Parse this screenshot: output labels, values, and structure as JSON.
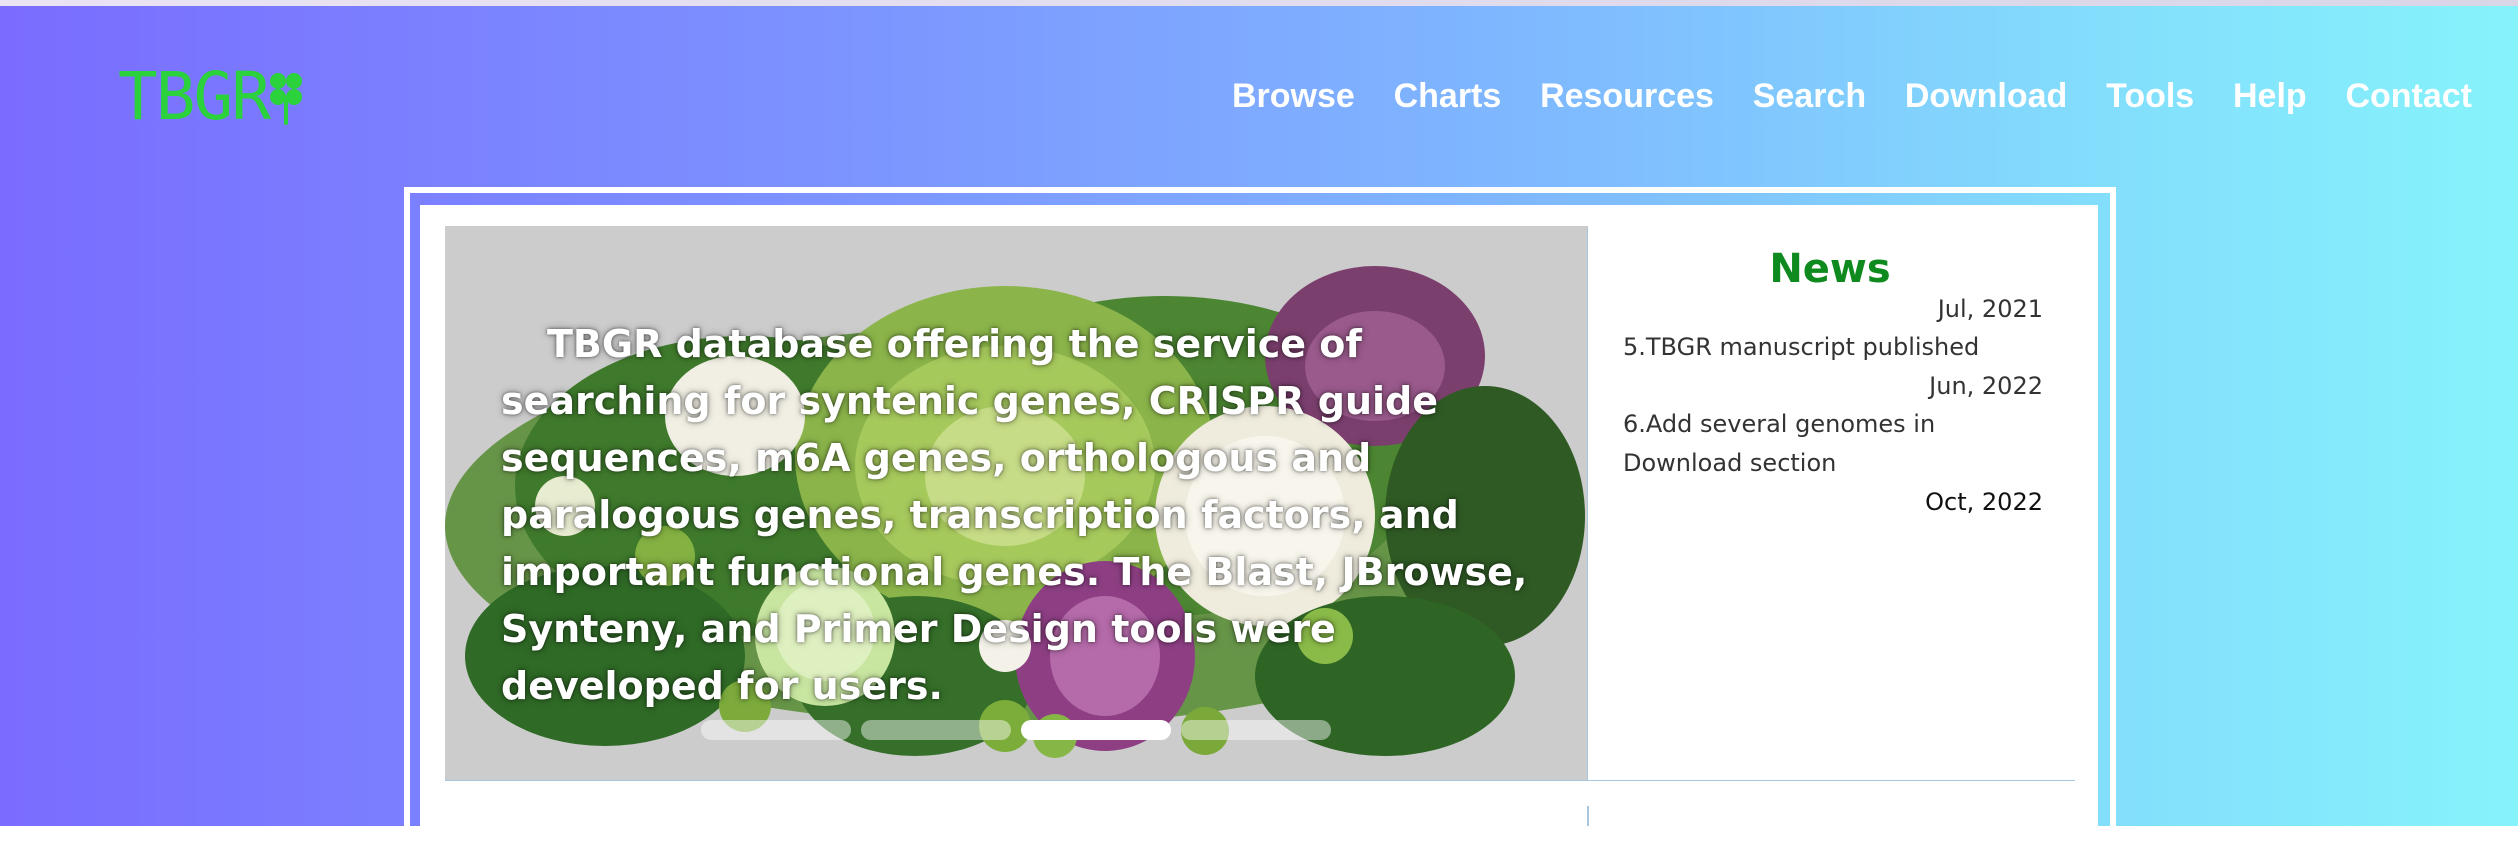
{
  "logo": {
    "text": "TBGR"
  },
  "nav": [
    {
      "label": "Browse"
    },
    {
      "label": "Charts"
    },
    {
      "label": "Resources"
    },
    {
      "label": "Search"
    },
    {
      "label": "Download"
    },
    {
      "label": "Tools"
    },
    {
      "label": "Help"
    },
    {
      "label": "Contact"
    }
  ],
  "carousel": {
    "text": "TBGR database offering the service of searching for syntenic genes, CRISPR guide sequences, m6A genes, orthologous and paralogous genes, transcription factors, and important functional genes. The Blast, JBrowse, Synteny, and Primer Design tools were developed for users.",
    "image_subject": "vegetables",
    "slide_count": 4,
    "active_slide": 3
  },
  "news": {
    "title": "News",
    "entries": [
      {
        "date": "Jul, 2021"
      },
      {
        "text": "5.TBGR manuscript published",
        "date": "Jun, 2022"
      },
      {
        "text": "6.Add several genomes in Download section",
        "date": "Oct, 2022"
      }
    ]
  },
  "colors": {
    "logo": "#2bd23c",
    "news_title": "#0f8a1f",
    "gradient_start": "#7a6cff",
    "gradient_end": "#86f3fb"
  },
  "icons": {
    "logo_mark": "clover-icon"
  }
}
